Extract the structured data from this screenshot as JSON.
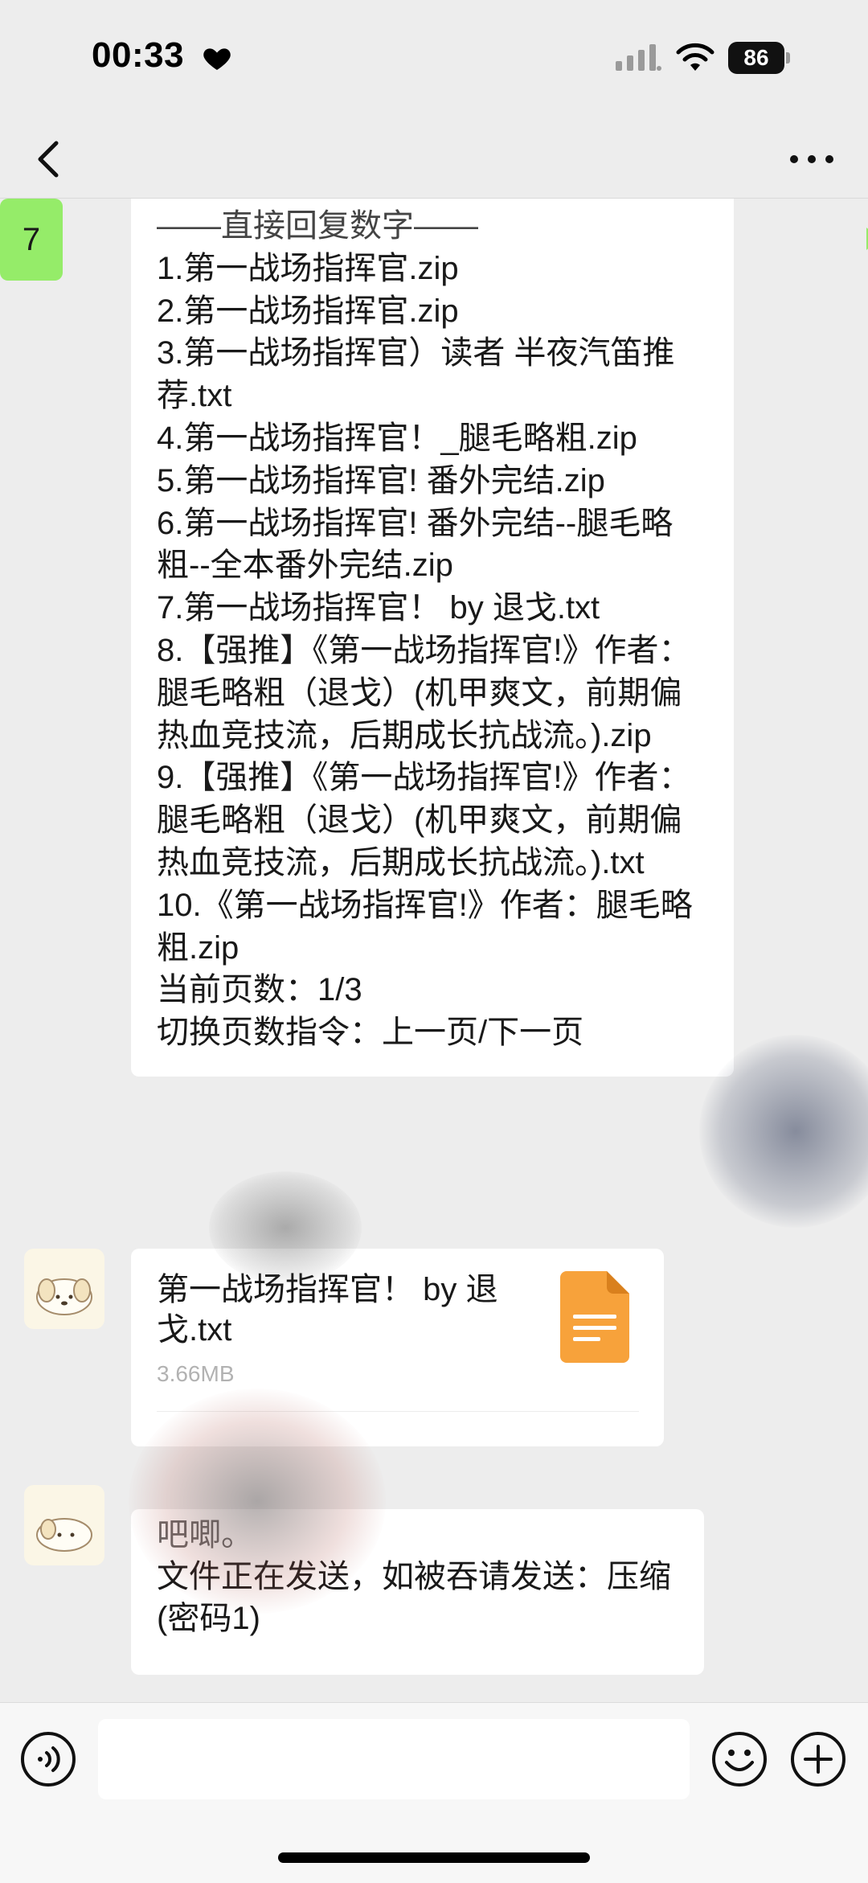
{
  "status_bar": {
    "time": "00:33",
    "battery": "86",
    "icons": [
      "heart-icon",
      "signal-icon",
      "wifi-icon",
      "battery-icon"
    ]
  },
  "nav": {
    "back_icon": "chevron-left-icon",
    "more_icon": "ellipsis-icon"
  },
  "messages": {
    "list_bubble": {
      "header": "——直接回复数字——",
      "items": [
        "1.第一战场指挥官.zip",
        "2.第一战场指挥官.zip",
        "3.第一战场指挥官）读者 半夜汽笛推荐.txt",
        "4.第一战场指挥官！_腿毛略粗.zip",
        "5.第一战场指挥官! 番外完结.zip",
        "6.第一战场指挥官! 番外完结--腿毛略粗--全本番外完结.zip",
        "7.第一战场指挥官！ by 退戈.txt",
        "8.【强推】《第一战场指挥官!》作者：腿毛略粗（退戈）(机甲爽文，前期偏热血竞技流，后期成长抗战流。).zip",
        "9.【强推】《第一战场指挥官!》作者：腿毛略粗（退戈）(机甲爽文，前期偏热血竞技流，后期成长抗战流。).txt",
        "10.《第一战场指挥官!》作者：腿毛略粗.zip"
      ],
      "page_info": "当前页数：1/3",
      "page_hint": "切换页数指令：上一页/下一页"
    },
    "sent": {
      "text": "7"
    },
    "file_bubble": {
      "file_name": "第一战场指挥官！ by 退戈.txt",
      "file_size": "3.66MB",
      "file_icon": "txt-file-icon",
      "icon_color": "#f7a23b"
    },
    "text_bubble": {
      "line1": "吧唧。",
      "line2": "文件正在发送，如被吞请发送：压缩(密码1)"
    }
  },
  "input_bar": {
    "placeholder": "",
    "icons": [
      "voice-icon",
      "emoji-icon",
      "plus-icon"
    ]
  },
  "colors": {
    "background": "#ededed",
    "bubble_received": "#ffffff",
    "bubble_sent": "#95ec69"
  }
}
